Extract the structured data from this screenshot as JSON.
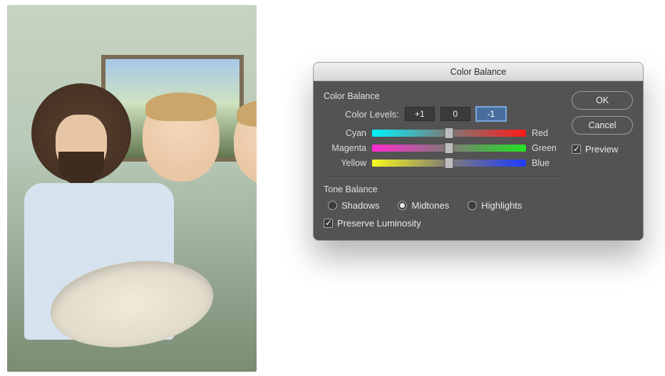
{
  "photo": {
    "description": "Painter at an easel holding a palette; two swapped-in smiling faces overlaid on the canvas area."
  },
  "dialog": {
    "title": "Color Balance",
    "buttons": {
      "ok": "OK",
      "cancel": "Cancel"
    },
    "preview": {
      "label": "Preview",
      "checked": true
    },
    "color_balance": {
      "heading": "Color Balance",
      "levels_label": "Color Levels:",
      "levels": {
        "cyan_red": "+1",
        "magenta_green": "0",
        "yellow_blue": "-1",
        "selected_index": 2
      },
      "sliders": [
        {
          "left": "Cyan",
          "right": "Red",
          "percent": 50
        },
        {
          "left": "Magenta",
          "right": "Green",
          "percent": 50
        },
        {
          "left": "Yellow",
          "right": "Blue",
          "percent": 50
        }
      ]
    },
    "tone_balance": {
      "heading": "Tone Balance",
      "options": {
        "shadows": "Shadows",
        "midtones": "Midtones",
        "highlights": "Highlights"
      },
      "selected": "midtones",
      "preserve_luminosity": {
        "label": "Preserve Luminosity",
        "checked": true
      }
    }
  }
}
